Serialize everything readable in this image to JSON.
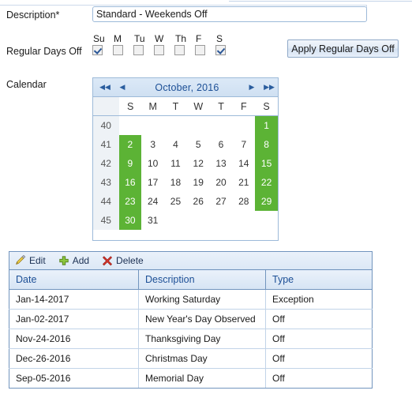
{
  "form": {
    "description_label": "Description*",
    "description_value": "Standard - Weekends Off",
    "description_placeholder": "",
    "regular_days_label": "Regular Days Off",
    "calendar_label": "Calendar",
    "apply_button": "Apply Regular Days Off"
  },
  "weekdays": [
    {
      "abbr": "Su",
      "checked": true
    },
    {
      "abbr": "M",
      "checked": false
    },
    {
      "abbr": "Tu",
      "checked": false
    },
    {
      "abbr": "W",
      "checked": false
    },
    {
      "abbr": "Th",
      "checked": false
    },
    {
      "abbr": "F",
      "checked": false
    },
    {
      "abbr": "S",
      "checked": true
    }
  ],
  "calendar": {
    "title": "October, 2016",
    "nav": {
      "first": "◀◀",
      "prev": "◀",
      "next": "▶",
      "last": "▶▶"
    },
    "week_col_header": "",
    "day_headers": [
      "S",
      "M",
      "T",
      "W",
      "T",
      "F",
      "S"
    ],
    "off_color": "#5cb335",
    "weeks": [
      {
        "num": "40",
        "days": [
          "",
          "",
          "",
          "",
          "",
          "",
          "1"
        ],
        "off": [
          false,
          false,
          false,
          false,
          false,
          false,
          true
        ]
      },
      {
        "num": "41",
        "days": [
          "2",
          "3",
          "4",
          "5",
          "6",
          "7",
          "8"
        ],
        "off": [
          true,
          false,
          false,
          false,
          false,
          false,
          true
        ]
      },
      {
        "num": "42",
        "days": [
          "9",
          "10",
          "11",
          "12",
          "13",
          "14",
          "15"
        ],
        "off": [
          true,
          false,
          false,
          false,
          false,
          false,
          true
        ]
      },
      {
        "num": "43",
        "days": [
          "16",
          "17",
          "18",
          "19",
          "20",
          "21",
          "22"
        ],
        "off": [
          true,
          false,
          false,
          false,
          false,
          false,
          true
        ]
      },
      {
        "num": "44",
        "days": [
          "23",
          "24",
          "25",
          "26",
          "27",
          "28",
          "29"
        ],
        "off": [
          true,
          false,
          false,
          false,
          false,
          false,
          true
        ]
      },
      {
        "num": "45",
        "days": [
          "30",
          "31",
          "",
          "",
          "",
          "",
          ""
        ],
        "off": [
          true,
          false,
          false,
          false,
          false,
          false,
          false
        ]
      }
    ]
  },
  "toolbar": {
    "edit_label": "Edit",
    "add_label": "Add",
    "delete_label": "Delete"
  },
  "table": {
    "headers": [
      "Date",
      "Description",
      "Type"
    ],
    "rows": [
      {
        "date": "Jan-14-2017",
        "description": "Working Saturday",
        "type": "Exception"
      },
      {
        "date": "Jan-02-2017",
        "description": "New Year's Day Observed",
        "type": "Off"
      },
      {
        "date": "Nov-24-2016",
        "description": "Thanksgiving Day",
        "type": "Off"
      },
      {
        "date": "Dec-26-2016",
        "description": "Christmas Day",
        "type": "Off"
      },
      {
        "date": "Sep-05-2016",
        "description": "Memorial Day",
        "type": "Off"
      }
    ]
  }
}
